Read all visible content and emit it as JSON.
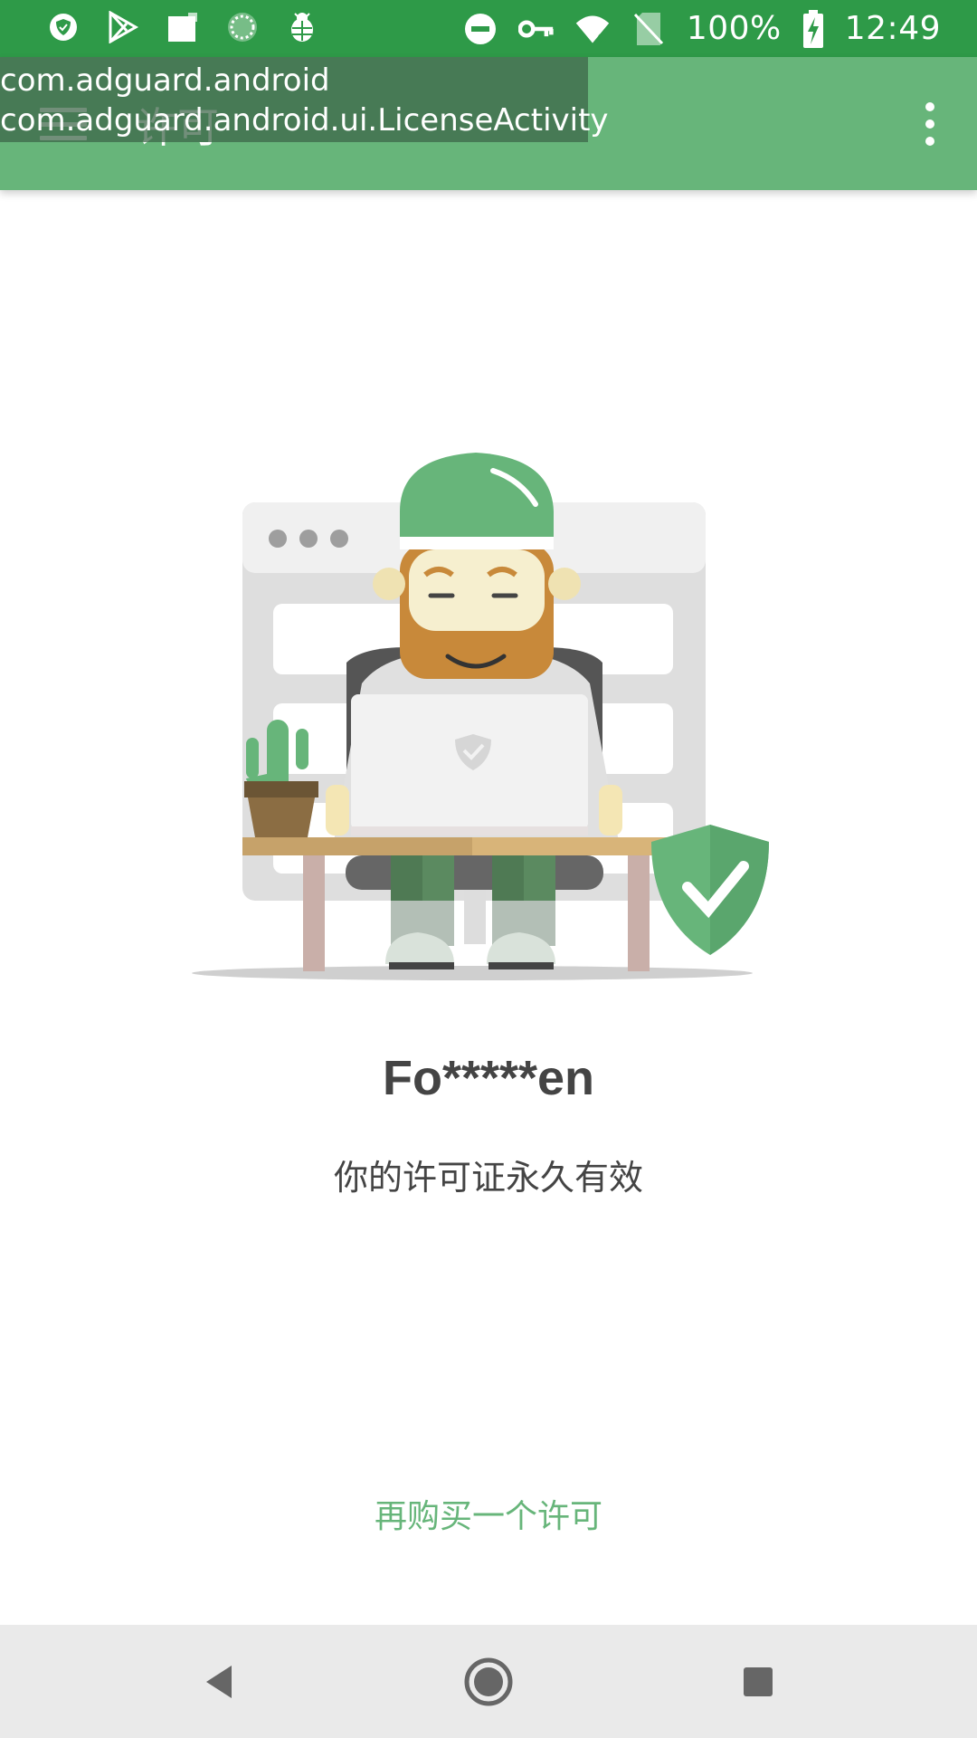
{
  "status_bar": {
    "battery_percent": "100%",
    "time": "12:49",
    "left_icons": [
      "adguard-shield-icon",
      "play-store-icon",
      "square-icon",
      "sync-circle-icon",
      "bug-icon"
    ],
    "right_icons": [
      "do-not-disturb-icon",
      "vpn-key-icon",
      "wifi-icon",
      "no-sim-icon",
      "battery-charging-icon"
    ]
  },
  "app_bar": {
    "title": "许可"
  },
  "debug_overlay": {
    "package": "com.adguard.android",
    "activity": "com.adguard.android.ui.LicenseActivity"
  },
  "license": {
    "user_name": "Fo*****en",
    "status": "你的许可证永久有效",
    "buy_again": "再购买一个许可"
  },
  "colors": {
    "status_bar": "#2e9a48",
    "app_bar": "#67b57a",
    "accent": "#67b57a",
    "text": "#444444",
    "nav_bar": "#eaeaea"
  }
}
